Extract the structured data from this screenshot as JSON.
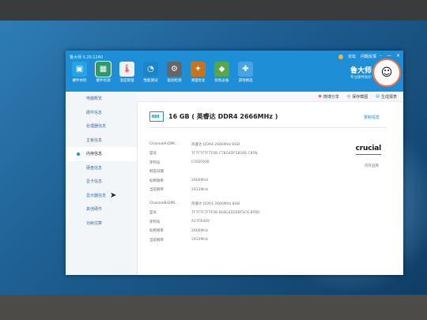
{
  "app": {
    "title": "鲁大师 5.20.1240",
    "top_links": [
      "论坛",
      "问题反馈"
    ],
    "window_buttons": [
      "–",
      "—",
      "×"
    ],
    "brand_name": "鲁大师",
    "brand_slogan": "专注硬件防护"
  },
  "toolbar": [
    {
      "label": "硬件体检",
      "icon": "computer-icon",
      "color": "#27a3e8"
    },
    {
      "label": "硬件检测",
      "icon": "chip-icon",
      "color": "#2d9a6b"
    },
    {
      "label": "温度管理",
      "icon": "thermometer-icon",
      "color": "#f0f0f0"
    },
    {
      "label": "性能测试",
      "icon": "speedometer-icon",
      "color": "#1a86c8"
    },
    {
      "label": "驱动检测",
      "icon": "driver-icon",
      "color": "#666"
    },
    {
      "label": "清理优化",
      "icon": "broom-icon",
      "color": "#c7741a"
    },
    {
      "label": "装机必备",
      "icon": "apps-icon",
      "color": "#56a845"
    },
    {
      "label": "游戏精选",
      "icon": "gamepad-icon",
      "color": "#4aa3e0"
    }
  ],
  "sidebar": [
    {
      "label": "电脑概览"
    },
    {
      "label": "硬件信息"
    },
    {
      "label": "处理器信息"
    },
    {
      "label": "主板信息"
    },
    {
      "label": "内存信息"
    },
    {
      "label": "硬盘信息"
    },
    {
      "label": "显卡信息"
    },
    {
      "label": "显示器信息"
    },
    {
      "label": "其他硬件"
    },
    {
      "label": "功耗估算"
    }
  ],
  "actions": [
    {
      "label": "微博分享",
      "icon": "weibo-icon"
    },
    {
      "label": "保存截图",
      "icon": "camera-icon"
    },
    {
      "label": "生成报表",
      "icon": "report-icon"
    }
  ],
  "memory": {
    "title": "16 GB ( 英睿达 DDR4 2666MHz )",
    "detail_link": "复制信息",
    "brand_logo": "crucial",
    "brand_label": "内存品牌",
    "channels": [
      {
        "rows": [
          {
            "key": "ChannelA-DIM...",
            "value": "英睿达 DDR4 2666MHz 8GB"
          },
          {
            "key": "型号",
            "value": "7F7F7F7F7F0B CT8G4DFS8266.C8FN"
          },
          {
            "key": "序列号",
            "value": "E35EF608"
          },
          {
            "key": "制造日期",
            "value": ""
          },
          {
            "key": "标称频率",
            "value": "2666MHz"
          },
          {
            "key": "当前频率",
            "value": "2933MHz"
          }
        ]
      },
      {
        "rows": [
          {
            "key": "ChannelB-DIM...",
            "value": "英睿达 DDR4 2666MHz 8GB"
          },
          {
            "key": "型号",
            "value": "7F7F7F7F7F0B BL8G4D26BFSCK.8FBD"
          },
          {
            "key": "序列号",
            "value": "A1TFB409"
          },
          {
            "key": "标称频率",
            "value": "2666MHz"
          },
          {
            "key": "当前频率",
            "value": "2933MHz"
          }
        ]
      }
    ]
  }
}
